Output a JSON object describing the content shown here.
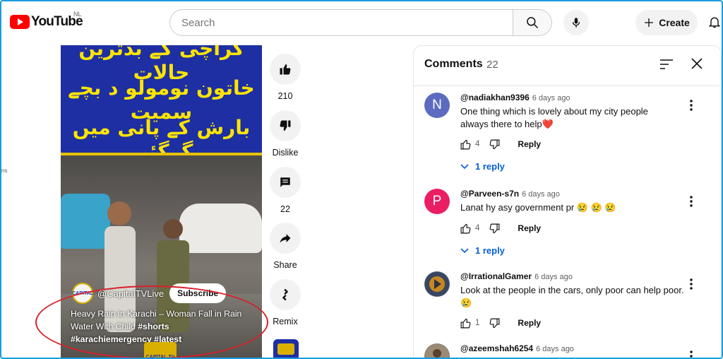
{
  "header": {
    "logo_text": "YouTube",
    "region": "NL",
    "search_placeholder": "Search",
    "create_label": "Create"
  },
  "sidebar_fragment": "ns",
  "video": {
    "urdu_lines": [
      "کراچی کے بدترین حالات",
      "خاتون نومولو د بچے سمیت",
      "بارش کے پانی میں گرگئی"
    ],
    "channel": "@CapitalTVLive",
    "subscribe_label": "Subscribe",
    "title_line1": "Heavy Rain in Karachi – Woman Fall in Rain",
    "title_line2_text": "Water With Child ",
    "title_line2_tag": "#shorts",
    "title_line3_tag1": "#karachiemergency",
    "title_line3_tag2": "#latest",
    "watermark": "CAPITAL TV",
    "channel_avatar_text": "CAPITAL"
  },
  "actions": {
    "likes": "210",
    "dislike_label": "Dislike",
    "comments": "22",
    "share_label": "Share",
    "remix_label": "Remix"
  },
  "comments_panel": {
    "title": "Comments",
    "count": "22",
    "comments": [
      {
        "initial": "N",
        "avatar_color": "#5c6bc0",
        "handle": "@nadiakhan9396",
        "time": "6 days ago",
        "text": "One thing which is lovely about my city people always there to help❤️",
        "likes": "4",
        "reply_label": "Reply",
        "replies_label": "1 reply"
      },
      {
        "initial": "P",
        "avatar_color": "#e91e63",
        "handle": "@Parveen-s7n",
        "time": "6 days ago",
        "text": "Lanat hy asy government pr 😢 😢 😢",
        "likes": "4",
        "reply_label": "Reply",
        "replies_label": "1 reply"
      },
      {
        "initial": "",
        "avatar_color": "#4a5a78",
        "handle": "@IrrationalGamer",
        "time": "6 days ago",
        "text": "Look at the people in the cars, only poor can help poor. 😢",
        "likes": "1",
        "reply_label": "Reply"
      },
      {
        "initial": "",
        "avatar_color": "#8a7a6a",
        "handle": "@azeemshah6254",
        "time": "6 days ago"
      }
    ]
  }
}
